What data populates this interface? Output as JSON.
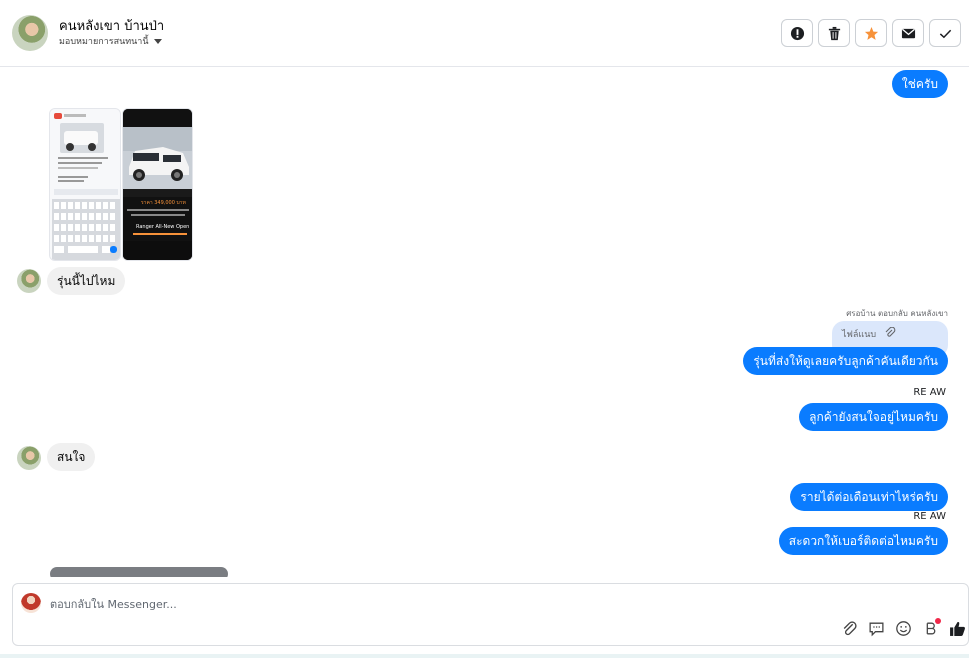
{
  "header": {
    "contact_name": "คนหลังเขา บ้านป่า",
    "assign_label": "มอบหมายการสนทนานี้",
    "tools": [
      {
        "icon": "alert-circle-icon",
        "name": "mark-spam"
      },
      {
        "icon": "trash-icon",
        "name": "delete"
      },
      {
        "icon": "star-icon",
        "name": "star"
      },
      {
        "icon": "envelope-icon",
        "name": "mark-unread"
      },
      {
        "icon": "checkmark-icon",
        "name": "done"
      }
    ],
    "star_color": "#f7923a"
  },
  "messages": {
    "m1": "ใช่ครับ",
    "m2": "รุ่นนี้ไปไหม",
    "reply_meta": "ศรอบ้าน ตอบกลับ คนหลังเขา",
    "reply_attachment": "ไฟล์แนบ",
    "m3": "รุ่นที่ส่งให้ดูเลยครับลูกค้าคันเดียวกัน",
    "sender_label_1": "RE AW",
    "m4": "ลูกค้ายังสนใจอยู่ไหมครับ",
    "m5": "สนใจ",
    "m6": "รายได้ต่อเดือนเท่าไหร่ครับ",
    "sender_label_2": "RE AW",
    "m7": "สะดวกให้เบอร์ติดต่อไหมครับ"
  },
  "thumb2_price": "ราคา 349,000 บาท",
  "thumb2_title": "Ranger All-New Open",
  "composer": {
    "placeholder": "ตอบกลับใน Messenger...",
    "icons": [
      "attachment-icon",
      "saved-reply-icon",
      "emoji-icon",
      "bot-icon",
      "like-icon"
    ]
  },
  "colors": {
    "outgoing_bubble": "#0a7cff",
    "incoming_bubble": "#f0f0f0",
    "reply_box": "#dbe7fb"
  }
}
